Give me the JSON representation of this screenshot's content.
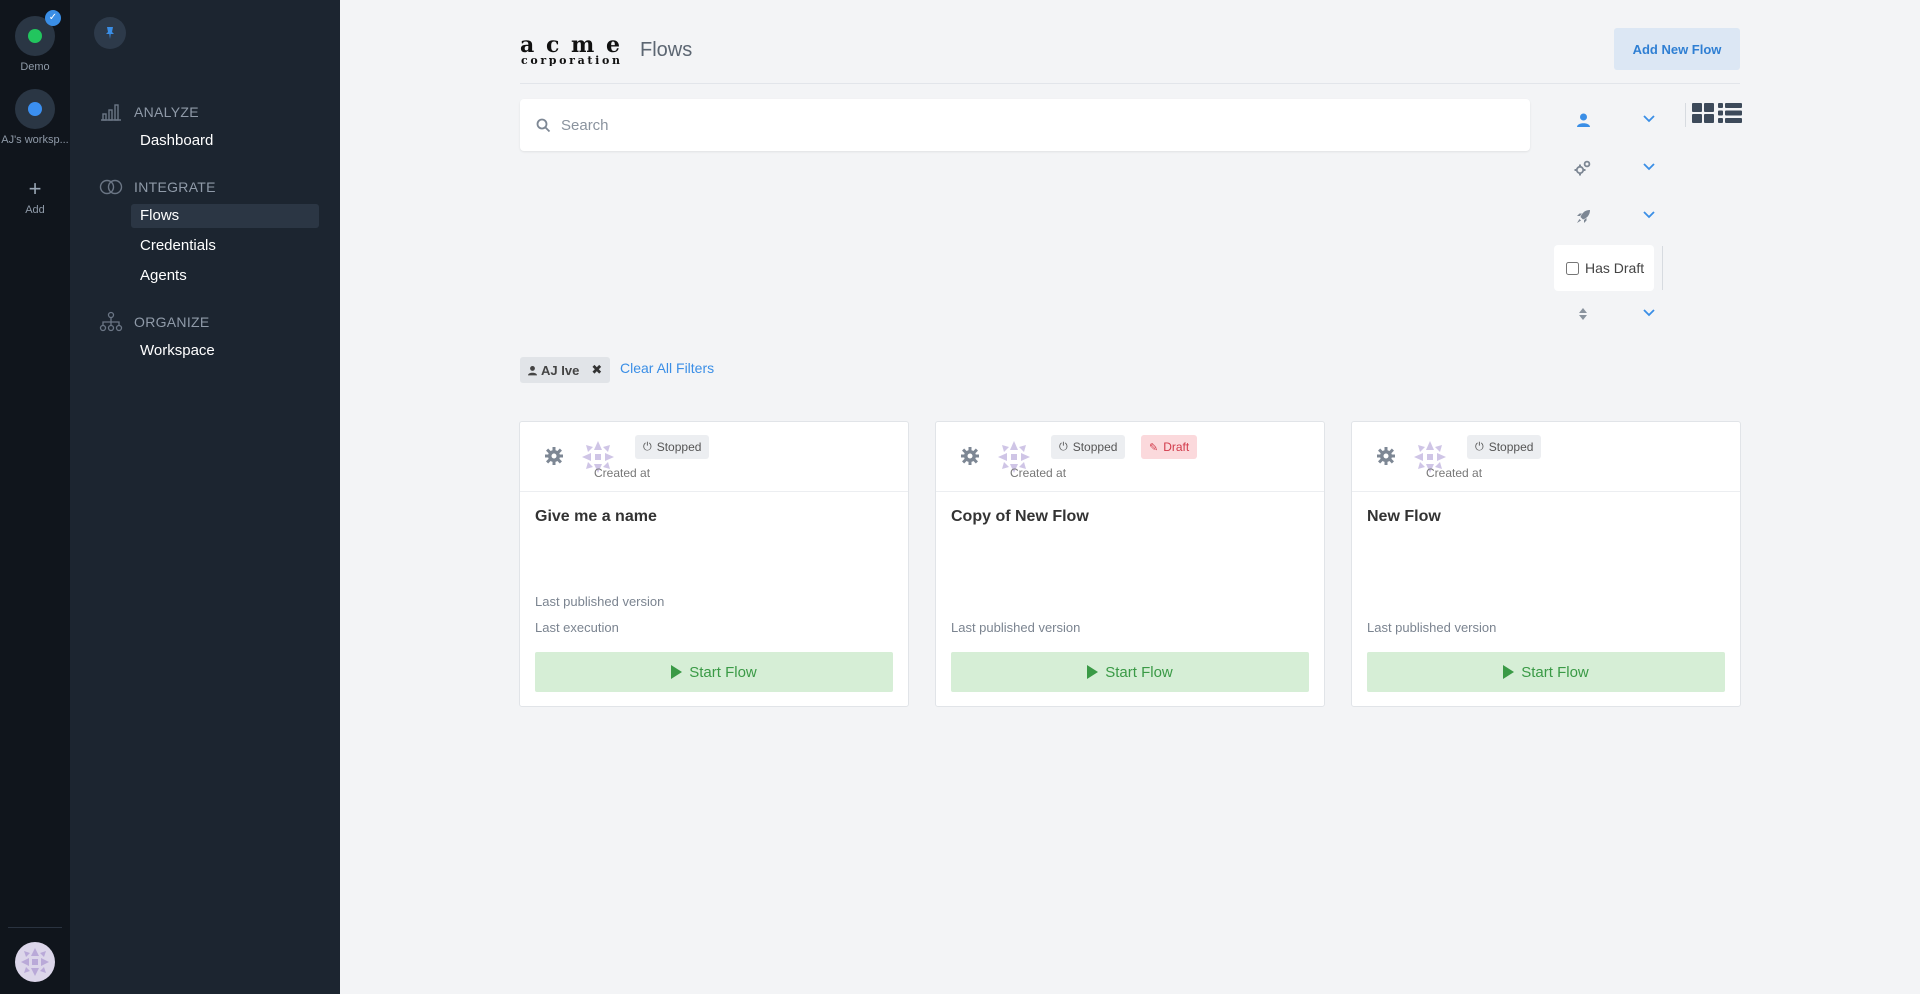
{
  "workspaces": [
    {
      "label": "Demo",
      "dot_color": "#22c55e",
      "checked": true
    },
    {
      "label": "AJ's worksp...",
      "dot_color": "#3b8ff0",
      "checked": false
    }
  ],
  "rail": {
    "add_label": "Add"
  },
  "nav": {
    "sections": [
      {
        "title": "ANALYZE",
        "icon": "bar-chart-icon",
        "items": [
          {
            "label": "Dashboard",
            "active": false
          }
        ]
      },
      {
        "title": "INTEGRATE",
        "icon": "rings-icon",
        "items": [
          {
            "label": "Flows",
            "active": true
          },
          {
            "label": "Credentials",
            "active": false
          },
          {
            "label": "Agents",
            "active": false
          }
        ]
      },
      {
        "title": "ORGANIZE",
        "icon": "org-chart-icon",
        "items": [
          {
            "label": "Workspace",
            "active": false
          }
        ]
      }
    ]
  },
  "header": {
    "logo_text": "acme corporation",
    "title": "Flows",
    "add_button": "Add New Flow"
  },
  "search": {
    "placeholder": "Search",
    "value": ""
  },
  "filters": {
    "rows": [
      "user-icon",
      "gears-icon",
      "rocket-icon"
    ],
    "has_draft_label": "Has Draft",
    "sort_icon": "sort-icon",
    "active_chip": "AJ Ive",
    "clear_all": "Clear All Filters"
  },
  "colors": {
    "accent": "#3a8ee6",
    "start": "#3a9a46",
    "draft": "#d23a4a"
  },
  "cards": [
    {
      "status": "Stopped",
      "draft": false,
      "created_label": "Created at",
      "title": "Give me a name",
      "last_published": "Last published version",
      "last_execution": "Last execution",
      "start_label": "Start Flow"
    },
    {
      "status": "Stopped",
      "draft": true,
      "draft_label": "Draft",
      "created_label": "Created at",
      "title": "Copy of New Flow",
      "last_published": "Last published version",
      "start_label": "Start Flow"
    },
    {
      "status": "Stopped",
      "draft": false,
      "created_label": "Created at",
      "title": "New Flow",
      "last_published": "Last published version",
      "start_label": "Start Flow"
    }
  ]
}
